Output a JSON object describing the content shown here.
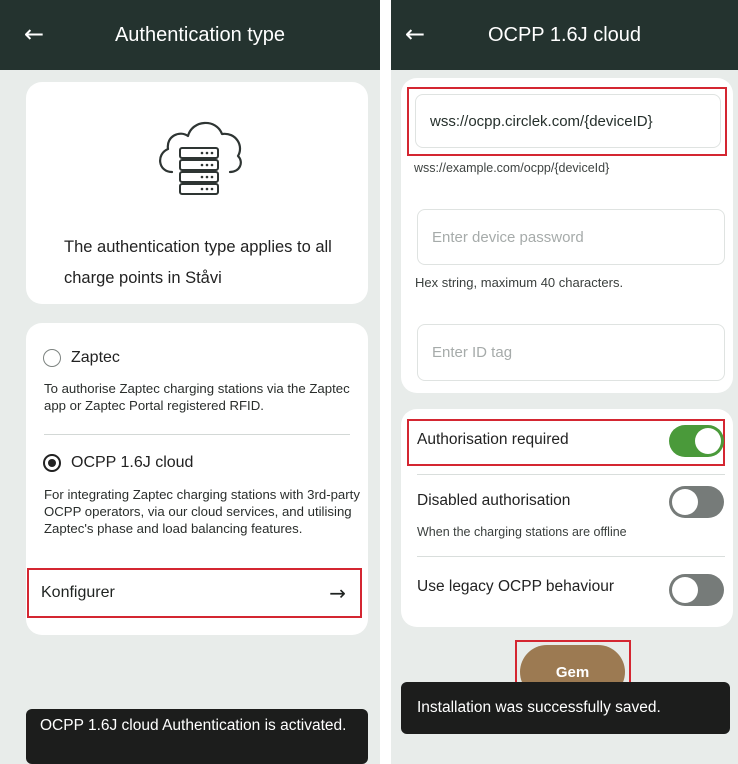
{
  "left": {
    "title": "Authentication type",
    "info_text": "The authentication type applies to all charge points in Ståvi",
    "options": [
      {
        "label": "Zaptec",
        "selected": false,
        "description": "To authorise Zaptec charging stations via the Zaptec app or Zaptec Portal registered RFID."
      },
      {
        "label": "OCPP 1.6J cloud",
        "selected": true,
        "description": "For integrating Zaptec charging stations with 3rd-party OCPP operators, via our cloud services, and utilising Zaptec's phase and load balancing features."
      }
    ],
    "configure_label": "Konfigurer",
    "toast": "OCPP 1.6J cloud Authentication is activated."
  },
  "right": {
    "title": "OCPP 1.6J cloud",
    "url_value": "wss://ocpp.circlek.com/{deviceID}",
    "url_hint": "wss://example.com/ocpp/{deviceId}",
    "password_placeholder": "Enter device password",
    "password_hint": "Hex string, maximum 40 characters.",
    "idtag_placeholder": "Enter ID tag",
    "toggles": [
      {
        "label": "Authorisation required",
        "on": true
      },
      {
        "label": "Disabled authorisation",
        "sublabel": "When the charging stations are offline",
        "on": false
      },
      {
        "label": "Use legacy OCPP behaviour",
        "on": false
      }
    ],
    "save_label": "Gem",
    "toast": "Installation was successfully saved."
  },
  "colors": {
    "appbar": "#24332f",
    "highlight": "#d42631",
    "toggle_on": "#4a9a3a",
    "toggle_off": "#767b79",
    "save_button": "#9c7a52"
  }
}
